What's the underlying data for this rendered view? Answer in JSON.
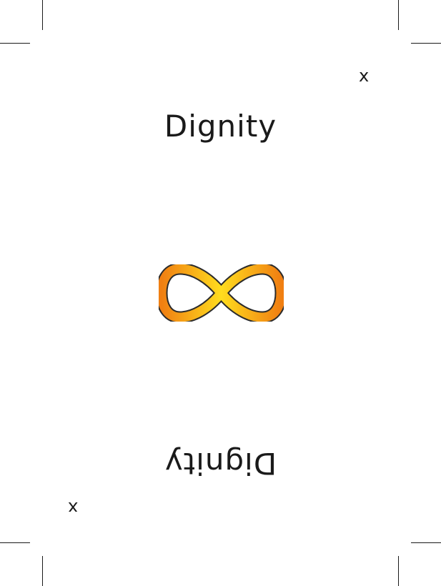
{
  "card": {
    "title_top": "Dignity",
    "title_bottom": "Dignity",
    "mark_top": "x",
    "mark_bottom": "x"
  },
  "symbol": {
    "icon": "infinity-icon",
    "colors": {
      "outer": "#f18a14",
      "inner": "#ffd21a",
      "outline": "#2b2b2b"
    }
  }
}
